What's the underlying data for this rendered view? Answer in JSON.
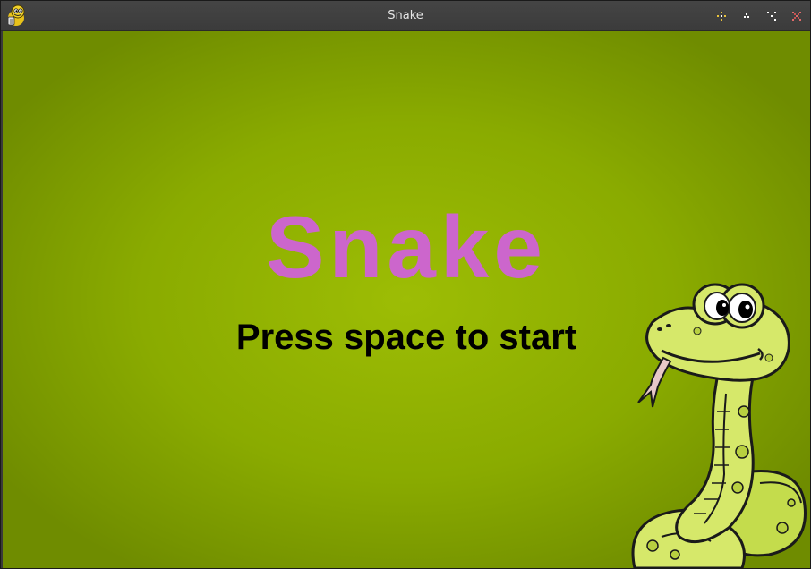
{
  "window": {
    "title": "Snake",
    "app_icon": "pygame-snake-icon",
    "controls": [
      {
        "name": "minimize-icon"
      },
      {
        "name": "shade-icon"
      },
      {
        "name": "maximize-icon"
      },
      {
        "name": "close-icon"
      }
    ]
  },
  "game": {
    "title": "Snake",
    "prompt": "Press space to start",
    "title_color": "#cc66cc",
    "prompt_color": "#000000",
    "background_color": "#8aab00",
    "mascot": "cartoon-snake-image"
  }
}
